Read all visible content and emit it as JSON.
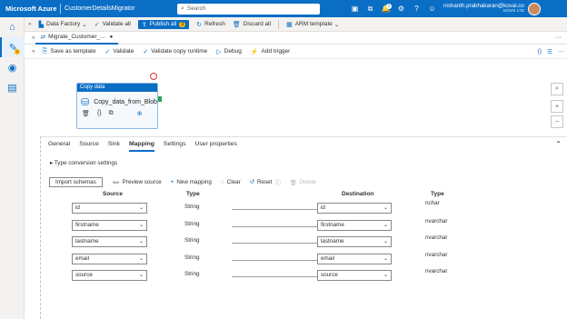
{
  "topbar": {
    "brand": "Microsoft Azure",
    "resource": "CustomerDetailsMigrator",
    "search_placeholder": "Search",
    "notif_count": "1",
    "user_name": "nishanth.prabhakaran@kovai.co",
    "user_org": "KOVAI LTD"
  },
  "toolbar": {
    "data_factory": "Data Factory",
    "validate_all": "Validate all",
    "publish_all": "Publish all",
    "publish_count": "3",
    "refresh": "Refresh",
    "discard_all": "Discard all",
    "arm_template": "ARM template"
  },
  "tab": {
    "label": "Migrate_Customer_..."
  },
  "pipeline_toolbar": {
    "save_as_template": "Save as template",
    "validate": "Validate",
    "validate_copy_runtime": "Validate copy runtime",
    "debug": "Debug",
    "add_trigger": "Add trigger"
  },
  "activity": {
    "type_label": "Copy data",
    "name": "Copy_data_from_Blob"
  },
  "properties": {
    "tabs": [
      "General",
      "Source",
      "Sink",
      "Mapping",
      "Settings",
      "User properties"
    ],
    "active_tab": "Mapping",
    "type_conversion": "Type conversion settings",
    "import_schemas": "Import schemas",
    "preview_source": "Preview source",
    "new_mapping": "New mapping",
    "clear": "Clear",
    "reset": "Reset",
    "delete": "Delete",
    "headers": {
      "source": "Source",
      "type": "Type",
      "destination": "Destination",
      "dest_type": "Type"
    },
    "mappings": [
      {
        "source": "id",
        "type": "String",
        "destination": "id",
        "dest_type": "nchar"
      },
      {
        "source": "firstname",
        "type": "String",
        "destination": "firstname",
        "dest_type": "nvarchar"
      },
      {
        "source": "lastname",
        "type": "String",
        "destination": "lastname",
        "dest_type": "nvarchar"
      },
      {
        "source": "email",
        "type": "String",
        "destination": "email",
        "dest_type": "nvarchar"
      },
      {
        "source": "source",
        "type": "String",
        "destination": "source",
        "dest_type": "nvarchar"
      }
    ]
  },
  "colors": {
    "accent": "#0b6ec5",
    "warning": "#ffb900",
    "error": "#d13438",
    "success": "#2da44e"
  }
}
